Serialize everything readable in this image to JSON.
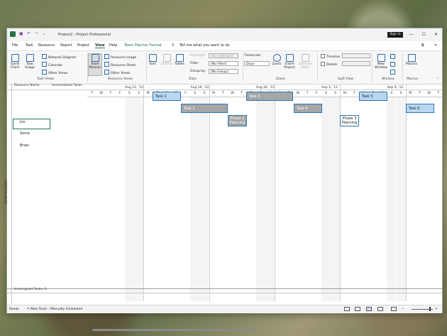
{
  "window": {
    "title": "Project2 - Project Professional",
    "signin": "Sign in",
    "min": "—",
    "max": "☐",
    "close": "✕"
  },
  "menu": {
    "tabs": [
      "File",
      "Task",
      "Resource",
      "Report",
      "Project",
      "View",
      "Help",
      "Team Planner Format"
    ],
    "active": "View",
    "search": "Tell me what you want to do"
  },
  "ribbon": {
    "task_views": {
      "label": "Task Views",
      "gantt": "Gantt Chart",
      "usage": "Task Usage",
      "network": "Network Diagram",
      "calendar": "Calendar",
      "other": "Other Views"
    },
    "resource_views": {
      "label": "Resource Views",
      "team": "Team Planner",
      "usage": "Resource Usage",
      "sheet": "Resource Sheet",
      "other": "Other Views"
    },
    "data": {
      "label": "Data",
      "sort": "Sort",
      "outline": "Outline",
      "tables": "Tables",
      "highlight_label": "Highlight:",
      "highlight_value": "[No Highlight]",
      "filter_label": "Filter:",
      "filter_value": "[No Filter]",
      "group_label": "Group by:",
      "group_value": "[No Group]"
    },
    "zoom": {
      "label": "Zoom",
      "timescale_label": "Timescale:",
      "timescale_value": "Days",
      "zoom": "Zoom",
      "entire": "Entire Project",
      "selected": "Selected Tasks"
    },
    "split": {
      "label": "Split View",
      "timeline": "Timeline",
      "details": "Details"
    },
    "window": {
      "label": "Window",
      "new_window": "New Window"
    },
    "macros": {
      "label": "Macros",
      "macros": "Macros"
    }
  },
  "planner": {
    "side_label": "TEAM PLANNER",
    "col_resource": "Resource Name",
    "col_unscheduled": "Unscheduled Tasks",
    "weeks": [
      "Aug 12, '12",
      "Aug 19, '12",
      "Aug 26, '12",
      "Sep 2, '12",
      "Sep 9, '12"
    ],
    "days": [
      "T",
      "W",
      "T",
      "F",
      "S",
      "S",
      "M",
      "T",
      "W",
      "T",
      "F",
      "S",
      "S",
      "M",
      "T",
      "W",
      "T",
      "F",
      "S",
      "S",
      "M",
      "T",
      "W",
      "T",
      "F",
      "S",
      "S",
      "M",
      "T",
      "W",
      "T",
      "F",
      "S",
      "S",
      "M",
      "T",
      "W",
      "T"
    ],
    "resources": [
      "Jon",
      "Sonia",
      "Brian"
    ],
    "tasks": {
      "task1": "Task 1",
      "task2": "Task 2",
      "task3": "Task 3",
      "task4": "Task 4",
      "task5": "Task 5",
      "task6": "Task 6",
      "phase2_a": "Phase 2",
      "phase2_b": "Planning",
      "phase3_a": "Phase 3",
      "phase3_b": "Planning"
    },
    "unassigned": "Unassigned Tasks: 0"
  },
  "status": {
    "ready": "Ready",
    "new_tasks": "New Tasks : Manually Scheduled"
  }
}
